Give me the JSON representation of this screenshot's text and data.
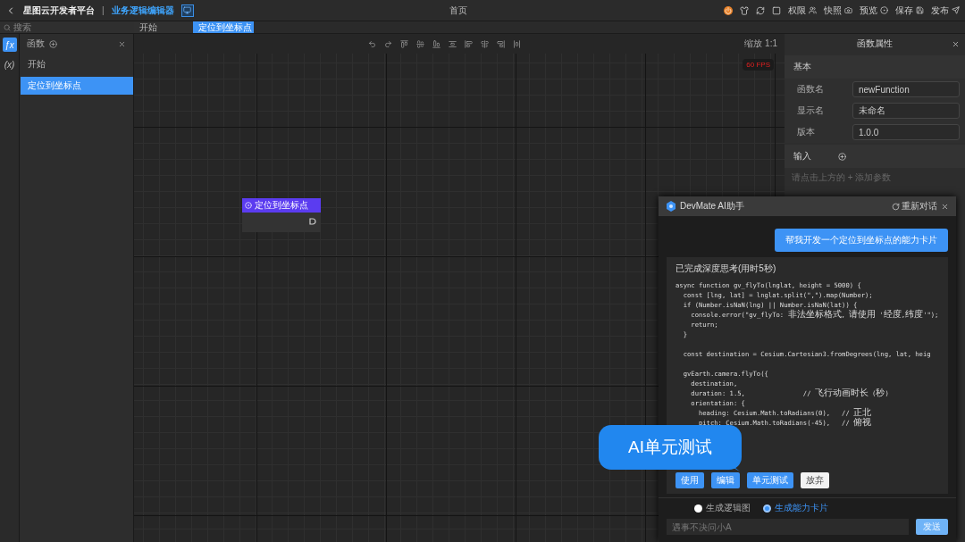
{
  "top_bar": {
    "title": "星图云开发者平台",
    "separator": "|",
    "subtitle": "业务逻辑编辑器",
    "center_title": "首页",
    "actions": [
      {
        "label": "权限"
      },
      {
        "label": "快照"
      },
      {
        "label": "预览"
      },
      {
        "label": "保存"
      },
      {
        "label": "发布"
      }
    ]
  },
  "search": {
    "placeholder": "搜索"
  },
  "rail": [
    {
      "label": "ƒx",
      "selected": true
    },
    {
      "label": "(x)",
      "selected": false
    }
  ],
  "tabs": [
    {
      "label": "开始",
      "selected": false
    },
    {
      "label": "定位到坐标点",
      "selected": true
    }
  ],
  "functions_panel": {
    "title": "函数",
    "items": [
      {
        "label": "开始",
        "selected": false
      },
      {
        "label": "定位到坐标点",
        "selected": true
      }
    ]
  },
  "canvas": {
    "zoom": "缩放 1:1",
    "fps": "60 FPS",
    "node": {
      "title": "定位到坐标点"
    }
  },
  "properties": {
    "title": "函数属性",
    "basic": {
      "title": "基本",
      "fields": [
        {
          "label": "函数名",
          "value": "newFunction"
        },
        {
          "label": "显示名",
          "value": "未命名"
        },
        {
          "label": "版本",
          "value": "1.0.0"
        }
      ]
    },
    "input": {
      "title": "输入",
      "hint": "请点击上方的 + 添加参数"
    }
  },
  "chat": {
    "title": "DevMate AI助手",
    "restart": "重新对话",
    "user_message": "帮我开发一个定位到坐标点的能力卡片",
    "answer": {
      "status": "已完成深度思考(用时5秒)",
      "code": [
        [
          "async function gv_flyTo(lnglat, height = 5000) {",
          "  const [lng, lat] = lnglat.split(\",\").map(Number);",
          "  if (Number.isNaN(lng) || Number.isNaN(lat)) {",
          "    console.error(\"gv_flyTo: 非法坐标格式, 请使用 '经度,纬度'\");",
          "    return;",
          "  }"
        ],
        [
          "  const destination = Cesium.Cartesian3.fromDegrees(lng, lat, heig"
        ],
        [
          "  gvEarth.camera.flyTo({",
          "    destination,",
          "    duration: 1.5,               // 飞行动画时长 (秒)",
          "    orientation: {",
          "      heading: Cesium.Math.toRadians(0),   // 正北",
          "      pitch: Cesium.Math.toRadians(-45),   // 俯视"
        ]
      ],
      "buttons": [
        {
          "label": "使用",
          "kind": "primary"
        },
        {
          "label": "编辑",
          "kind": "primary"
        },
        {
          "label": "单元测试",
          "kind": "primary"
        },
        {
          "label": "放弃",
          "kind": "secondary"
        }
      ]
    },
    "modes": [
      {
        "label": "生成逻辑图",
        "selected": false
      },
      {
        "label": "生成能力卡片",
        "selected": true
      }
    ],
    "input": {
      "placeholder": "遇事不决问小A"
    },
    "send": "发送"
  },
  "callout": {
    "text": "AI单元测试"
  }
}
